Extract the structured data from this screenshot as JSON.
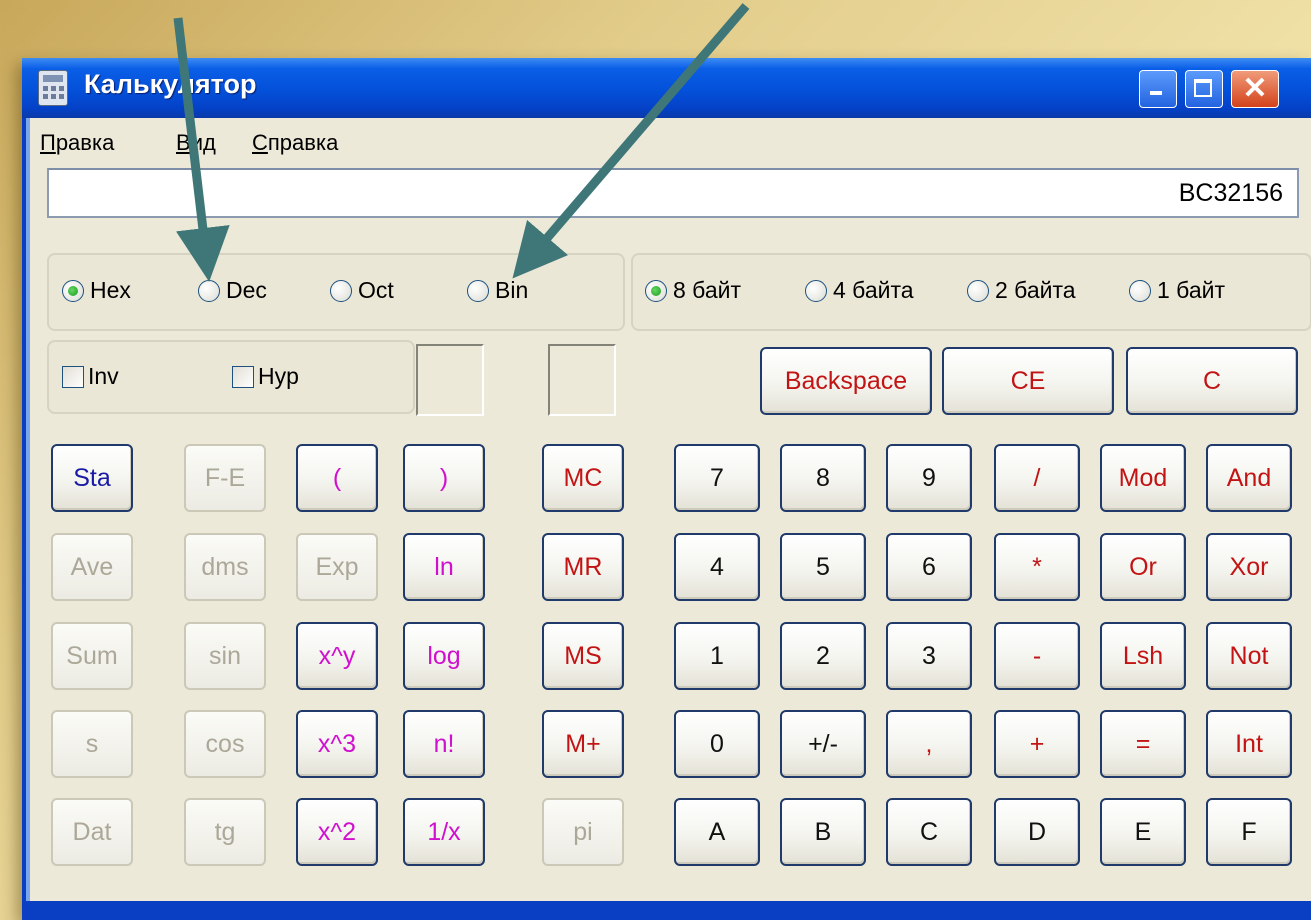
{
  "window": {
    "title": "Калькулятор"
  },
  "menu": [
    {
      "mnemonic": "П",
      "rest": "равка"
    },
    {
      "mnemonic": "В",
      "rest": "ид"
    },
    {
      "mnemonic": "С",
      "rest": "правка"
    }
  ],
  "display": {
    "value": "BC32156"
  },
  "number_system": {
    "options": [
      "Hex",
      "Dec",
      "Oct",
      "Bin"
    ],
    "selected": "Hex"
  },
  "word_size": {
    "options": [
      "8 байт",
      "4 байта",
      "2 байта",
      "1 байт"
    ],
    "selected": "8 байт"
  },
  "checks": {
    "inv": "Inv",
    "hyp": "Hyp"
  },
  "edit_buttons": {
    "backspace": "Backspace",
    "ce": "CE",
    "c": "C"
  },
  "keypad": {
    "sci": [
      "Sta",
      "F-E",
      "(",
      ")",
      "Ave",
      "dms",
      "Exp",
      "ln",
      "Sum",
      "sin",
      "x^y",
      "log",
      "s",
      "cos",
      "x^3",
      "n!",
      "Dat",
      "tg",
      "x^2",
      "1/x"
    ],
    "memory": [
      "MC",
      "MR",
      "MS",
      "M+",
      "pi"
    ],
    "main": [
      "7",
      "8",
      "9",
      "/",
      "Mod",
      "And",
      "4",
      "5",
      "6",
      "*",
      "Or",
      "Xor",
      "1",
      "2",
      "3",
      "-",
      "Lsh",
      "Not",
      "0",
      "+/-",
      ",",
      "+",
      "=",
      "Int",
      "A",
      "B",
      "C",
      "D",
      "E",
      "F"
    ]
  },
  "colors": {
    "titlebar": "#0450d9",
    "accent_red": "#c21414",
    "accent_blue": "#1a1aa6",
    "accent_magenta": "#d10fce",
    "arrow": "#3f7778"
  }
}
